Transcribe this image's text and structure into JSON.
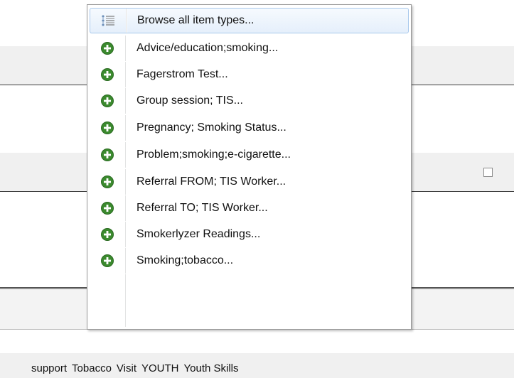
{
  "menu": {
    "items": [
      {
        "label": "Browse all item types...",
        "icon": "list-icon",
        "selected": true
      },
      {
        "label": "Advice/education;smoking...",
        "icon": "add-circle-icon"
      },
      {
        "label": "Fagerstrom Test...",
        "icon": "add-circle-icon"
      },
      {
        "label": "Group session; TIS...",
        "icon": "add-circle-icon"
      },
      {
        "label": "Pregnancy; Smoking Status...",
        "icon": "add-circle-icon"
      },
      {
        "label": "Problem;smoking;e-cigarette...",
        "icon": "add-circle-icon"
      },
      {
        "label": "Referral FROM; TIS Worker...",
        "icon": "add-circle-icon"
      },
      {
        "label": "Referral TO; TIS Worker...",
        "icon": "add-circle-icon"
      },
      {
        "label": "Smokerlyzer Readings...",
        "icon": "add-circle-icon"
      },
      {
        "label": "Smoking;tobacco...",
        "icon": "add-circle-icon"
      }
    ]
  },
  "tags": [
    "support",
    "Tobacco",
    "Visit",
    "YOUTH",
    "Youth Skills"
  ],
  "colors": {
    "plus_green": "#3b8a2e",
    "selection_border": "#a8c8ec",
    "menu_border": "#979797"
  }
}
